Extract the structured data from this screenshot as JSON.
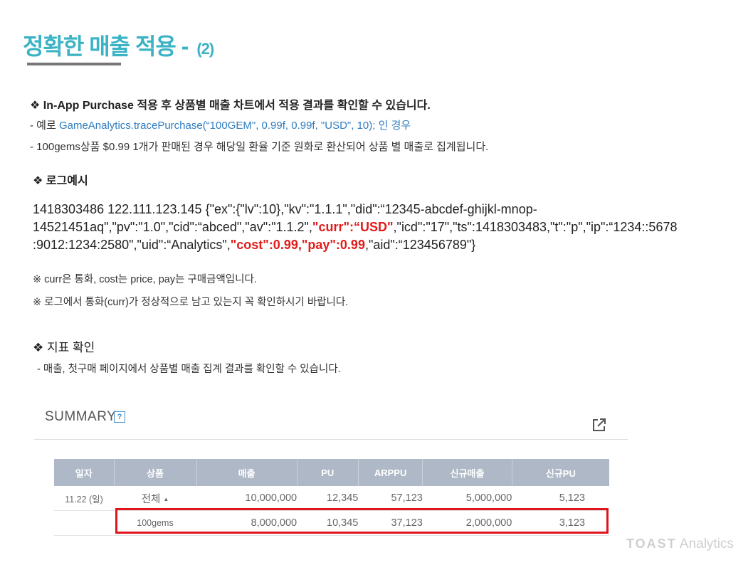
{
  "title": {
    "main": "정확한 매출 적용 -",
    "suffix": "(2)"
  },
  "section1": {
    "heading": "❖ In-App Purchase 적용 후 상품별 매출 차트에서 적용 결과를 확인할 수 있습니다.",
    "line1_prefix": " - 예로 ",
    "line1_code": "GameAnalytics.tracePurchase(“100GEM\", 0.99f, 0.99f, \"USD\", 10); 인 경우",
    "line2": " - 100gems상품 $0.99 1개가 판매된 경우 해당일 환율 기준 원화로 환산되어 상품 별 매출로 집계됩니다."
  },
  "section2": {
    "heading": "❖ 로그예시",
    "log_part1": "1418303486  122.111.123.145 {\"ex\":{\"lv\":10},\"kv\":\"1.1.1\",\"did\":“12345-abcdef-ghijkl-mnop-\n14521451aq\",\"pv\":\"1.0\",\"cid\":“abced\",\"av\":\"1.1.2\",",
    "log_red1": "\"curr\":“USD\"",
    "log_part2": ",\"icd\":\"17\",\"ts\":1418303483,\"t\":\"p\",\"ip\":“1234::5678\n:9012:1234:2580\",\"uid\":“Analytics\",",
    "log_red2": "\"cost\":0.99,\"pay\":0.99",
    "log_part3": ",\"aid\":“123456789\"}"
  },
  "notes": {
    "note1": "※  curr은 통화, cost는 price, pay는 구매금액입니다.",
    "note2": "※  로그에서 통화(curr)가 정상적으로 남고 있는지 꼭 확인하시기 바랍니다."
  },
  "section3": {
    "heading": "❖ 지표 확인",
    "line": " - 매출, 첫구매 페이지에서 상품별 매출 집계 결과를 확인할 수 있습니다."
  },
  "summary": {
    "title": "SUMMARY",
    "help_symbol": "?",
    "columns": [
      "일자",
      "상품",
      "매출",
      "PU",
      "ARPPU",
      "신규매출",
      "신규PU"
    ],
    "rows": [
      {
        "date": "11.22 (일)",
        "product": "전체",
        "revenue": "10,000,000",
        "pu": "12,345",
        "arppu": "57,123",
        "new_revenue": "5,000,000",
        "new_pu": "5,123"
      },
      {
        "date": "",
        "product": "100gems",
        "revenue": "8,000,000",
        "pu": "10,345",
        "arppu": "37,123",
        "new_revenue": "2,000,000",
        "new_pu": "3,123"
      }
    ]
  },
  "logo": {
    "brand": "TOAST",
    "product": "Analytics"
  },
  "colors": {
    "title": "#3ab3c4",
    "highlight": "#e0141c",
    "link": "#2f7cc0",
    "header_bg": "#aeb8c6"
  }
}
